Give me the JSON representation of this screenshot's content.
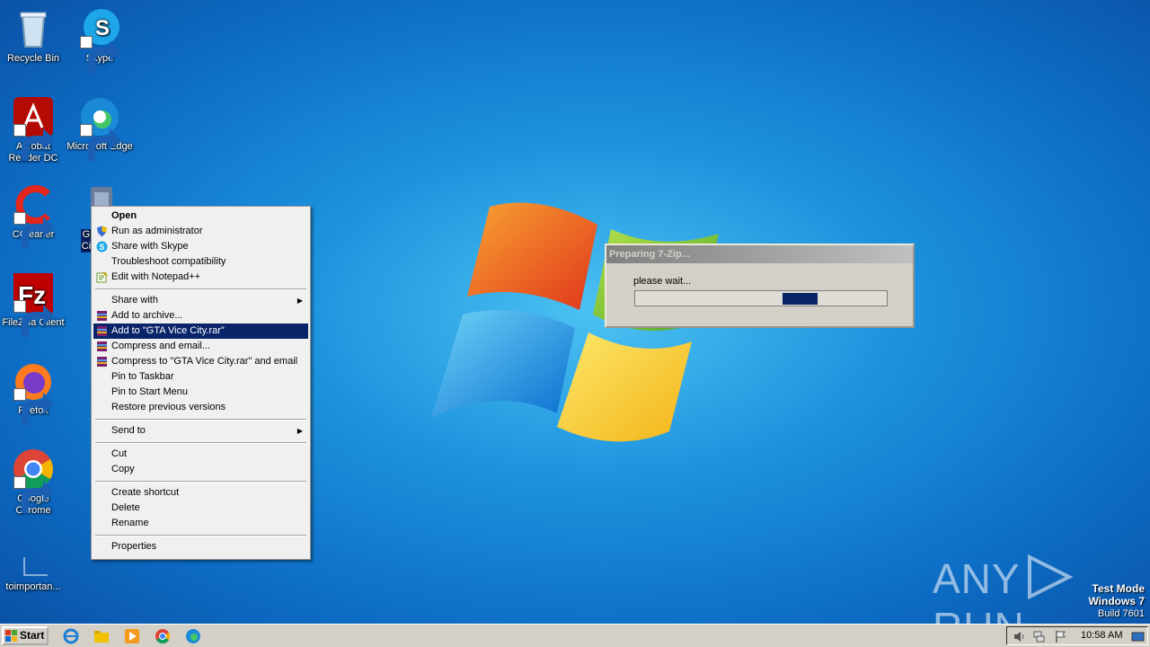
{
  "desktop": {
    "icons": [
      {
        "label": "Recycle Bin"
      },
      {
        "label": "Skype"
      },
      {
        "label": "Acrobat Reader DC"
      },
      {
        "label": "Microsoft Edge"
      },
      {
        "label": "CCleaner"
      },
      {
        "label": "GTA Vice City",
        "label_visible": "G Ci"
      },
      {
        "label": "FileZilla Client"
      },
      {
        "label": "Firefox"
      },
      {
        "label": "Google Chrome"
      },
      {
        "label": "toimportan..."
      }
    ]
  },
  "context_menu": {
    "items": [
      {
        "label": "Open"
      },
      {
        "label": "Run as administrator"
      },
      {
        "label": "Share with Skype"
      },
      {
        "label": "Troubleshoot compatibility"
      },
      {
        "label": "Edit with Notepad++"
      },
      {
        "label": "Share with"
      },
      {
        "label": "Add to archive..."
      },
      {
        "label": "Add to \"GTA Vice City.rar\""
      },
      {
        "label": "Compress and email..."
      },
      {
        "label": "Compress to \"GTA Vice City.rar\" and email"
      },
      {
        "label": "Pin to Taskbar"
      },
      {
        "label": "Pin to Start Menu"
      },
      {
        "label": "Restore previous versions"
      },
      {
        "label": "Send to"
      },
      {
        "label": "Cut"
      },
      {
        "label": "Copy"
      },
      {
        "label": "Create shortcut"
      },
      {
        "label": "Delete"
      },
      {
        "label": "Rename"
      },
      {
        "label": "Properties"
      }
    ],
    "highlight_color": "#0a246a"
  },
  "zip_dialog": {
    "title": "Preparing 7-Zip...",
    "message": "please wait...",
    "progress_color": "#0a246a"
  },
  "watermark": {
    "brand_left": "ANY",
    "brand_right": "RUN",
    "test_mode": "Test Mode",
    "os": "Windows 7",
    "build": "Build 7601"
  },
  "taskbar": {
    "start_label": "Start",
    "clock": "10:58 AM"
  }
}
